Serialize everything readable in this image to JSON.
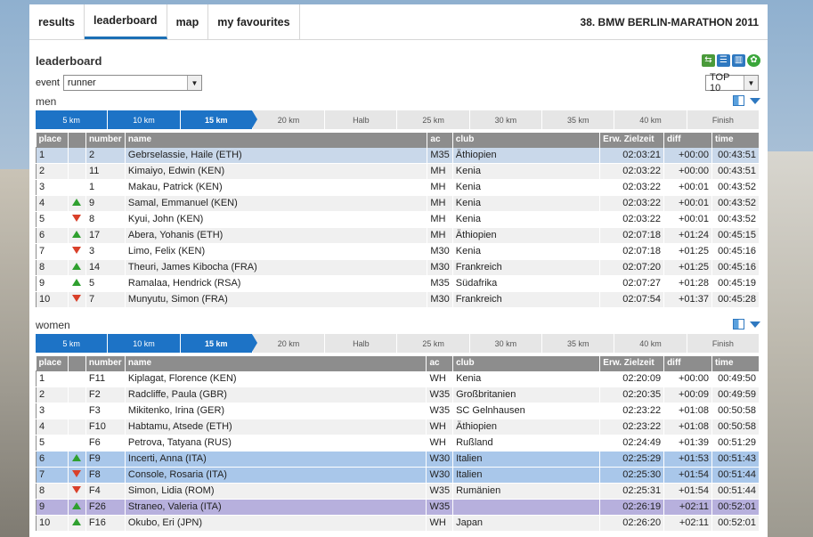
{
  "nav": {
    "tabs": [
      "results",
      "leaderboard",
      "map",
      "my favourites"
    ],
    "active": 1,
    "event_title": "38. BMW BERLIN-MARATHON 2011"
  },
  "leaderboard": {
    "title": "leaderboard",
    "event_label": "event",
    "event_value": "runner",
    "top_value": "TOP 10"
  },
  "splits": [
    "5 km",
    "10 km",
    "15 km",
    "20 km",
    "Halb",
    "25 km",
    "30 km",
    "35 km",
    "40 km",
    "Finish"
  ],
  "columns": [
    "place",
    "",
    "number",
    "name",
    "ac",
    "club",
    "Erw. Zielzeit",
    "diff",
    "time"
  ],
  "men": {
    "title": "men",
    "rows": [
      {
        "place": "1",
        "trend": "",
        "number": "2",
        "name": "Gebrselassie, Haile (ETH)",
        "ac": "M35",
        "club": "Äthiopien",
        "erw": "02:03:21",
        "diff": "+00:00",
        "time": "00:43:51",
        "style": "sel"
      },
      {
        "place": "2",
        "trend": "",
        "number": "11",
        "name": "Kimaiyo, Edwin (KEN)",
        "ac": "MH",
        "club": "Kenia",
        "erw": "02:03:22",
        "diff": "+00:00",
        "time": "00:43:51",
        "style": ""
      },
      {
        "place": "3",
        "trend": "",
        "number": "1",
        "name": "Makau, Patrick (KEN)",
        "ac": "MH",
        "club": "Kenia",
        "erw": "02:03:22",
        "diff": "+00:01",
        "time": "00:43:52",
        "style": ""
      },
      {
        "place": "4",
        "trend": "up",
        "number": "9",
        "name": "Samal, Emmanuel (KEN)",
        "ac": "MH",
        "club": "Kenia",
        "erw": "02:03:22",
        "diff": "+00:01",
        "time": "00:43:52",
        "style": ""
      },
      {
        "place": "5",
        "trend": "down",
        "number": "8",
        "name": "Kyui, John (KEN)",
        "ac": "MH",
        "club": "Kenia",
        "erw": "02:03:22",
        "diff": "+00:01",
        "time": "00:43:52",
        "style": ""
      },
      {
        "place": "6",
        "trend": "up",
        "number": "17",
        "name": "Abera, Yohanis (ETH)",
        "ac": "MH",
        "club": "Äthiopien",
        "erw": "02:07:18",
        "diff": "+01:24",
        "time": "00:45:15",
        "style": ""
      },
      {
        "place": "7",
        "trend": "down",
        "number": "3",
        "name": "Limo, Felix (KEN)",
        "ac": "M30",
        "club": "Kenia",
        "erw": "02:07:18",
        "diff": "+01:25",
        "time": "00:45:16",
        "style": ""
      },
      {
        "place": "8",
        "trend": "up",
        "number": "14",
        "name": "Theuri, James Kibocha (FRA)",
        "ac": "M30",
        "club": "Frankreich",
        "erw": "02:07:20",
        "diff": "+01:25",
        "time": "00:45:16",
        "style": ""
      },
      {
        "place": "9",
        "trend": "up",
        "number": "5",
        "name": "Ramalaa, Hendrick (RSA)",
        "ac": "M35",
        "club": "Südafrika",
        "erw": "02:07:27",
        "diff": "+01:28",
        "time": "00:45:19",
        "style": ""
      },
      {
        "place": "10",
        "trend": "down",
        "number": "7",
        "name": "Munyutu, Simon (FRA)",
        "ac": "M30",
        "club": "Frankreich",
        "erw": "02:07:54",
        "diff": "+01:37",
        "time": "00:45:28",
        "style": ""
      }
    ]
  },
  "women": {
    "title": "women",
    "rows": [
      {
        "place": "1",
        "trend": "",
        "number": "F11",
        "name": "Kiplagat, Florence (KEN)",
        "ac": "WH",
        "club": "Kenia",
        "erw": "02:20:09",
        "diff": "+00:00",
        "time": "00:49:50",
        "style": ""
      },
      {
        "place": "2",
        "trend": "",
        "number": "F2",
        "name": "Radcliffe, Paula (GBR)",
        "ac": "W35",
        "club": "Großbritanien",
        "erw": "02:20:35",
        "diff": "+00:09",
        "time": "00:49:59",
        "style": ""
      },
      {
        "place": "3",
        "trend": "",
        "number": "F3",
        "name": "Mikitenko, Irina (GER)",
        "ac": "W35",
        "club": "SC Gelnhausen",
        "erw": "02:23:22",
        "diff": "+01:08",
        "time": "00:50:58",
        "style": ""
      },
      {
        "place": "4",
        "trend": "",
        "number": "F10",
        "name": "Habtamu, Atsede (ETH)",
        "ac": "WH",
        "club": "Äthiopien",
        "erw": "02:23:22",
        "diff": "+01:08",
        "time": "00:50:58",
        "style": ""
      },
      {
        "place": "5",
        "trend": "",
        "number": "F6",
        "name": "Petrova, Tatyana (RUS)",
        "ac": "WH",
        "club": "Rußland",
        "erw": "02:24:49",
        "diff": "+01:39",
        "time": "00:51:29",
        "style": ""
      },
      {
        "place": "6",
        "trend": "up",
        "number": "F9",
        "name": "Incerti, Anna (ITA)",
        "ac": "W30",
        "club": "Italien",
        "erw": "02:25:29",
        "diff": "+01:53",
        "time": "00:51:43",
        "style": "hl-blue"
      },
      {
        "place": "7",
        "trend": "down",
        "number": "F8",
        "name": "Console, Rosaria (ITA)",
        "ac": "W30",
        "club": "Italien",
        "erw": "02:25:30",
        "diff": "+01:54",
        "time": "00:51:44",
        "style": "hl-blue"
      },
      {
        "place": "8",
        "trend": "down",
        "number": "F4",
        "name": "Simon, Lidia (ROM)",
        "ac": "W35",
        "club": "Rumänien",
        "erw": "02:25:31",
        "diff": "+01:54",
        "time": "00:51:44",
        "style": ""
      },
      {
        "place": "9",
        "trend": "up",
        "number": "F26",
        "name": "Straneo, Valeria (ITA)",
        "ac": "W35",
        "club": "",
        "erw": "02:26:19",
        "diff": "+02:11",
        "time": "00:52:01",
        "style": "hl-purple"
      },
      {
        "place": "10",
        "trend": "up",
        "number": "F16",
        "name": "Okubo, Eri (JPN)",
        "ac": "WH",
        "club": "Japan",
        "erw": "02:26:20",
        "diff": "+02:11",
        "time": "00:52:01",
        "style": ""
      }
    ]
  },
  "icons": [
    "bike-runner-icon",
    "list-view-icon",
    "columns-view-icon",
    "settings-wheel-icon"
  ],
  "colors": {
    "accent": "#1d73c6",
    "up": "#2fa02f",
    "down": "#d9402a"
  }
}
